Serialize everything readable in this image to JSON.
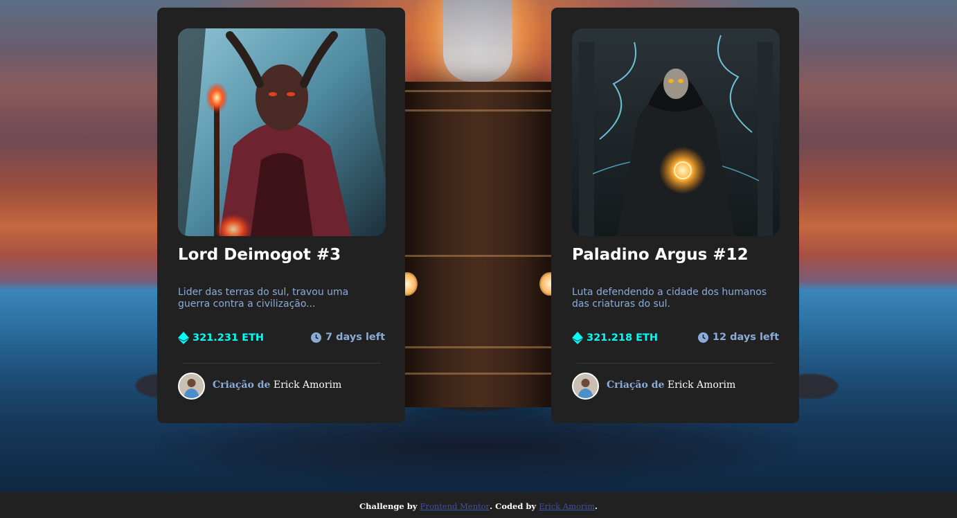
{
  "cards": [
    {
      "title": "Lord Deimogot #3",
      "description": "Lider das terras do sul, travou uma guerra contra a civilização...",
      "price": "321.231 ETH",
      "time_left": "7 days left",
      "creator_prefix": "Criação de",
      "creator_name": "Erick Amorim"
    },
    {
      "title": "Paladino Argus #12",
      "description": "Luta defendendo a cidade dos humanos das criaturas do sul.",
      "price": "321.218 ETH",
      "time_left": "12 days left",
      "creator_prefix": "Criação de",
      "creator_name": "Erick Amorim"
    }
  ],
  "footer": {
    "prefix": "Challenge by",
    "link1": "Frontend Mentor",
    "middle": ". Coded by",
    "link2": "Erick Amorim",
    "suffix": "."
  },
  "colors": {
    "card_bg": "#212121",
    "accent_cyan": "#00fff8",
    "soft_blue": "#8bacd9",
    "footer_link": "#3e52a3"
  },
  "icons": [
    "ethereum-icon",
    "clock-icon"
  ]
}
